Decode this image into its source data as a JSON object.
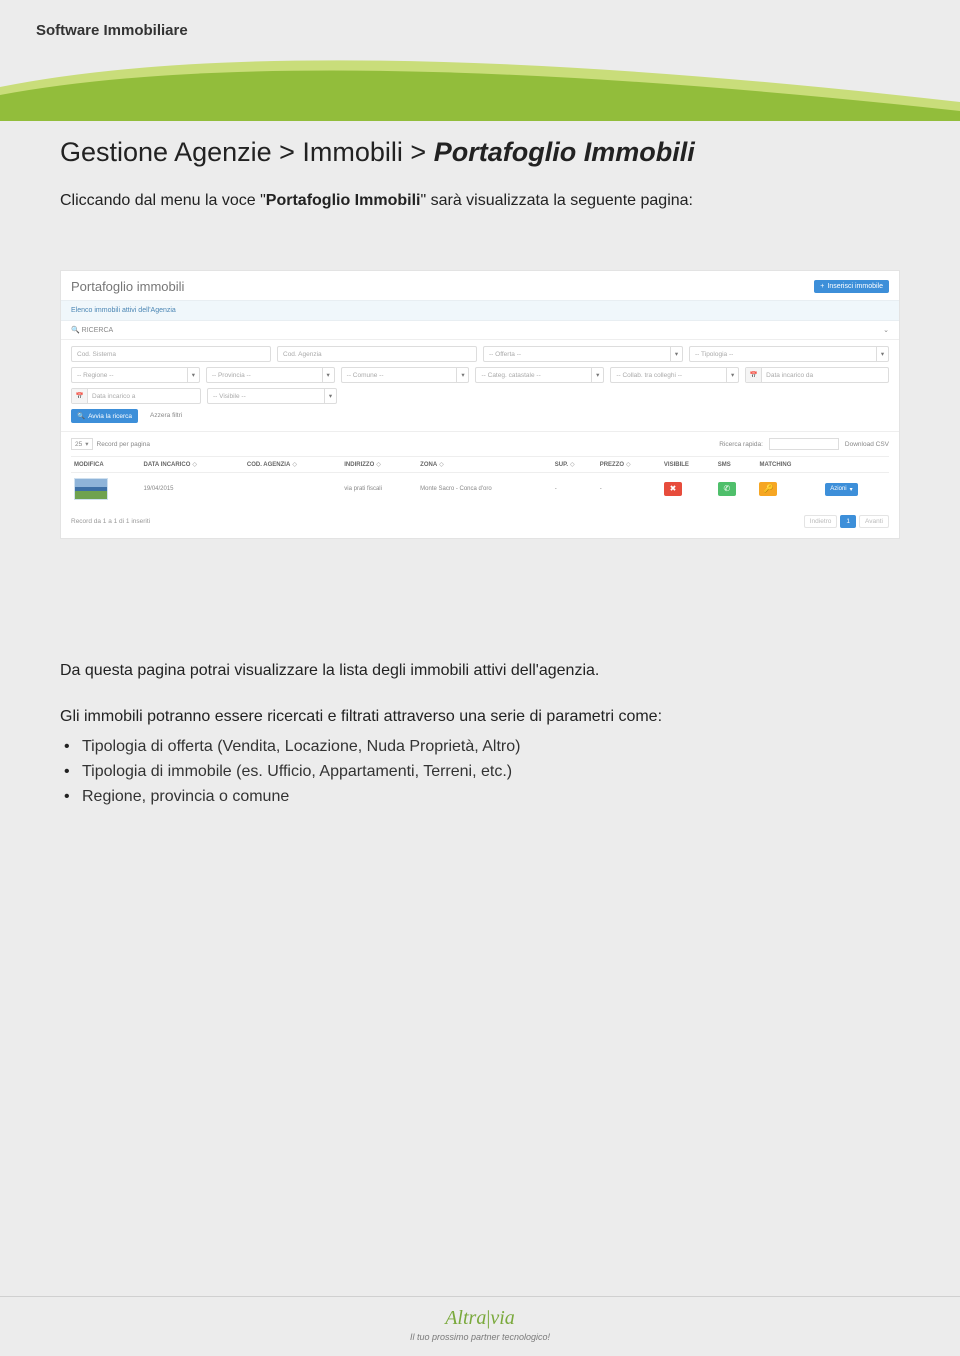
{
  "header": {
    "title": "Software Immobiliare"
  },
  "breadcrumb": {
    "full_plain": "Gestione Agenzie > Immobili > ",
    "emph": "Portafoglio Immobili"
  },
  "intro": {
    "pre": "Cliccando dal menu la voce \"",
    "bold": "Portafoglio Immobili",
    "post": "\" sarà visualizzata la seguente pagina:"
  },
  "shot": {
    "title": "Portafoglio immobili",
    "insert_btn": "Inserisci immobile",
    "band": "Elenco immobili attivi dell'Agenzia",
    "ricerca_label": "RICERCA",
    "filters": {
      "cod_sistema": "Cod. Sistema",
      "cod_agenzia": "Cod. Agenzia",
      "offerta": "-- Offerta --",
      "tipologia": "-- Tipologia --",
      "regione": "-- Regione --",
      "provincia": "-- Provincia --",
      "comune": "-- Comune --",
      "categ": "-- Categ. catastale --",
      "collab": "-- Collab. tra colleghi --",
      "data_da": "Data incarico da",
      "data_a": "Data incarico a",
      "visibile": "-- Visibile --"
    },
    "btn_search": "Avvia la ricerca",
    "btn_reset": "Azzera filtri",
    "per_page_value": "25",
    "per_page_label": "Record per pagina",
    "quick_search_label": "Ricerca rapida:",
    "download": "Download CSV",
    "columns": {
      "modifica": "MODIFICA",
      "data_incarico": "DATA INCARICO",
      "cod_agenzia": "COD. AGENZIA",
      "indirizzo": "INDIRIZZO",
      "zona": "ZONA",
      "sup": "SUP.",
      "prezzo": "PREZZO",
      "visibile": "VISIBILE",
      "sms": "SMS",
      "matching": "MATCHING"
    },
    "row": {
      "data": "19/04/2015",
      "cod": "",
      "indirizzo": "via prati fiscali",
      "zona": "Monte Sacro - Conca d'oro",
      "sup": "-",
      "prezzo": "-",
      "azioni": "Azioni"
    },
    "footer_text": "Record da 1 a 1 di 1 inseriti",
    "pager_prev": "Indietro",
    "pager_cur": "1",
    "pager_next": "Avanti"
  },
  "body": {
    "p1": "Da questa pagina potrai visualizzare la lista degli immobili attivi dell'agenzia.",
    "p2": "Gli immobili potranno essere ricercati e filtrati attraverso una serie di parametri come:",
    "bullets": [
      "Tipologia di offerta (Vendita, Locazione, Nuda Proprietà, Altro)",
      "Tipologia di immobile (es. Ufficio, Appartamenti, Terreni, etc.)",
      "Regione, provincia o comune"
    ]
  },
  "footer": {
    "brand1": "Altra",
    "brand2": "via",
    "tagline": "Il tuo prossimo partner tecnologico!"
  },
  "glyphs": {
    "search": "🔍",
    "plus": "+",
    "caret": "▾",
    "chev": "⌄",
    "cal": "📅",
    "x": "✖",
    "phone": "✆",
    "key": "🔑",
    "sort": "◇"
  }
}
